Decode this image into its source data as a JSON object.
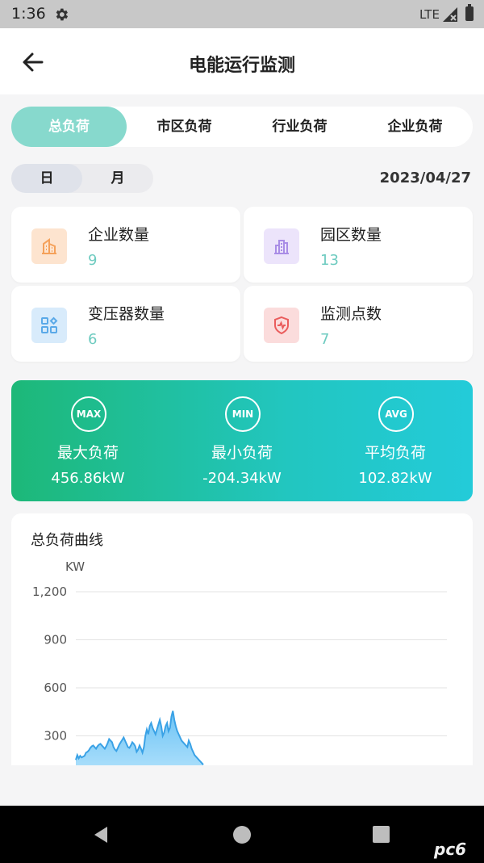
{
  "status_bar": {
    "time": "1:36",
    "network": "LTE",
    "icons": [
      "gear-icon",
      "signal-icon",
      "battery-icon"
    ]
  },
  "header": {
    "title": "电能运行监测",
    "back_icon": "arrow-left-icon"
  },
  "tabs": [
    {
      "label": "总负荷",
      "active": true
    },
    {
      "label": "市区负荷",
      "active": false
    },
    {
      "label": "行业负荷",
      "active": false
    },
    {
      "label": "企业负荷",
      "active": false
    }
  ],
  "period": {
    "day": "日",
    "month": "月",
    "selected": "日"
  },
  "date": "2023/04/27",
  "stats": [
    {
      "label": "企业数量",
      "value": "9",
      "icon": "building-icon",
      "icon_color": "#f5a15a",
      "icon_bg": "#fde4cf"
    },
    {
      "label": "园区数量",
      "value": "13",
      "icon": "park-buildings-icon",
      "icon_color": "#a98de6",
      "icon_bg": "#ece4fb"
    },
    {
      "label": "变压器数量",
      "value": "6",
      "icon": "transformer-grid-icon",
      "icon_color": "#5aa9e8",
      "icon_bg": "#d8ebfb"
    },
    {
      "label": "监测点数",
      "value": "7",
      "icon": "shield-pulse-icon",
      "icon_color": "#ea5c5c",
      "icon_bg": "#fbdcdc"
    }
  ],
  "metrics": [
    {
      "badge": "MAX",
      "label": "最大负荷",
      "value": "456.86kW"
    },
    {
      "badge": "MIN",
      "label": "最小负荷",
      "value": "-204.34kW"
    },
    {
      "badge": "AVG",
      "label": "平均负荷",
      "value": "102.82kW"
    }
  ],
  "chart_data": {
    "type": "area",
    "title": "总负荷曲线",
    "ylabel": "KW",
    "ylim": [
      0,
      1200
    ],
    "yticks": [
      300,
      600,
      900,
      1200
    ],
    "ytick_labels": [
      "300",
      "600",
      "900",
      "1,200"
    ],
    "grid": true,
    "color": "#5fb7ef",
    "series": [
      {
        "values": [
          150,
          180,
          160,
          175,
          165,
          170,
          175,
          195,
          200,
          210,
          225,
          235,
          240,
          230,
          220,
          235,
          245,
          250,
          240,
          230,
          220,
          235,
          255,
          280,
          270,
          260,
          230,
          215,
          205,
          225,
          245,
          260,
          275,
          290,
          270,
          250,
          230,
          225,
          240,
          260,
          250,
          235,
          200,
          215,
          240,
          220,
          195,
          230,
          300,
          340,
          310,
          360,
          380,
          350,
          330,
          310,
          340,
          370,
          400,
          360,
          300,
          320,
          360,
          380,
          330,
          350,
          420,
          456,
          400,
          360,
          330,
          310,
          290,
          270,
          260,
          250,
          240,
          230,
          270,
          250,
          220,
          200,
          180,
          170,
          160,
          150,
          140,
          130,
          120
        ]
      }
    ]
  },
  "nav_bar": {
    "icons": [
      "back-triangle-icon",
      "home-circle-icon",
      "recent-square-icon"
    ]
  },
  "watermark": "pc6"
}
